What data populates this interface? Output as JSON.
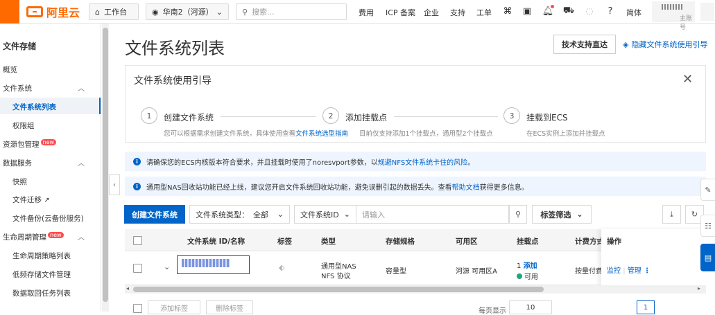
{
  "topbar": {
    "logo_text": "阿里云",
    "workbench": "工作台",
    "region": "华南2（河源）",
    "search_placeholder": "搜索...",
    "links": [
      "费用",
      "ICP 备案",
      "企业",
      "支持",
      "工单"
    ],
    "lang": "简体",
    "account_sub": "主账号"
  },
  "sidebar": {
    "title": "文件存储",
    "overview": "概览",
    "fs_group": "文件系统",
    "fs_list": "文件系统列表",
    "perm_group": "权限组",
    "res_pack": "资源包管理",
    "new_badge": "new",
    "data_service": "数据服务",
    "snapshot": "快照",
    "migration": "文件迁移",
    "backup": "文件备份(云备份服务)",
    "lifecycle": "生命周期管理",
    "lifecycle_policy": "生命周期策略列表",
    "low_freq": "低频存储文件管理",
    "data_retrieve": "数据取回任务列表"
  },
  "main": {
    "title": "文件系统列表",
    "tech_support": "技术支持直达",
    "hide_guide": "隐藏文件系统使用引导"
  },
  "guide": {
    "title": "文件系统使用引导",
    "steps": [
      {
        "num": "1",
        "title": "创建文件系统",
        "desc_pre": "您可以根据需求创建文件系统，具体使用查看",
        "desc_link": "文件系统选型指南"
      },
      {
        "num": "2",
        "title": "添加挂载点",
        "desc_pre": "目前仅支持添加1个挂载点，通用型2个挂载点",
        "desc_link": ""
      },
      {
        "num": "3",
        "title": "挂载到ECS",
        "desc_pre": "在ECS实例上添加并挂载点",
        "desc_link": ""
      }
    ]
  },
  "notices": [
    {
      "pre": "请确保您的ECS内核版本符合要求，并且挂载时使用了noresvport参数，以",
      "link": "规避NFS文件系统卡住的风险",
      "post": "。"
    },
    {
      "pre": "通用型NAS回收站功能已经上线，建议您开启文件系统回收站功能，避免误删引起的数据丢失。查看",
      "link": "帮助文档",
      "post": "获得更多信息。"
    }
  ],
  "toolbar": {
    "create": "创建文件系统",
    "type_label": "文件系统类型：",
    "type_value": "全部",
    "id_label": "文件系统ID",
    "search_placeholder": "请输入",
    "tag_filter": "标签筛选"
  },
  "table": {
    "headers": [
      "文件系统 ID/名称",
      "标签",
      "类型",
      "存储规格",
      "可用区",
      "挂载点",
      "计费方式",
      "操作"
    ],
    "row": {
      "type_line1": "通用型NAS",
      "type_line2": "NFS 协议",
      "spec": "容量型",
      "zone": "河源 可用区A",
      "mount_count": "1",
      "mount_add": "添加",
      "mount_status": "可用",
      "billing": "按量付费",
      "op_monitor": "监控",
      "op_manage": "管理"
    }
  },
  "footer": {
    "add_tag": "添加标签",
    "remove_tag": "删除标签",
    "per_page_label": "每页显示",
    "per_page": "10",
    "page": "1"
  },
  "colors": {
    "brand": "#ff6a00",
    "primary": "#0064c8",
    "success": "#21a67a"
  }
}
